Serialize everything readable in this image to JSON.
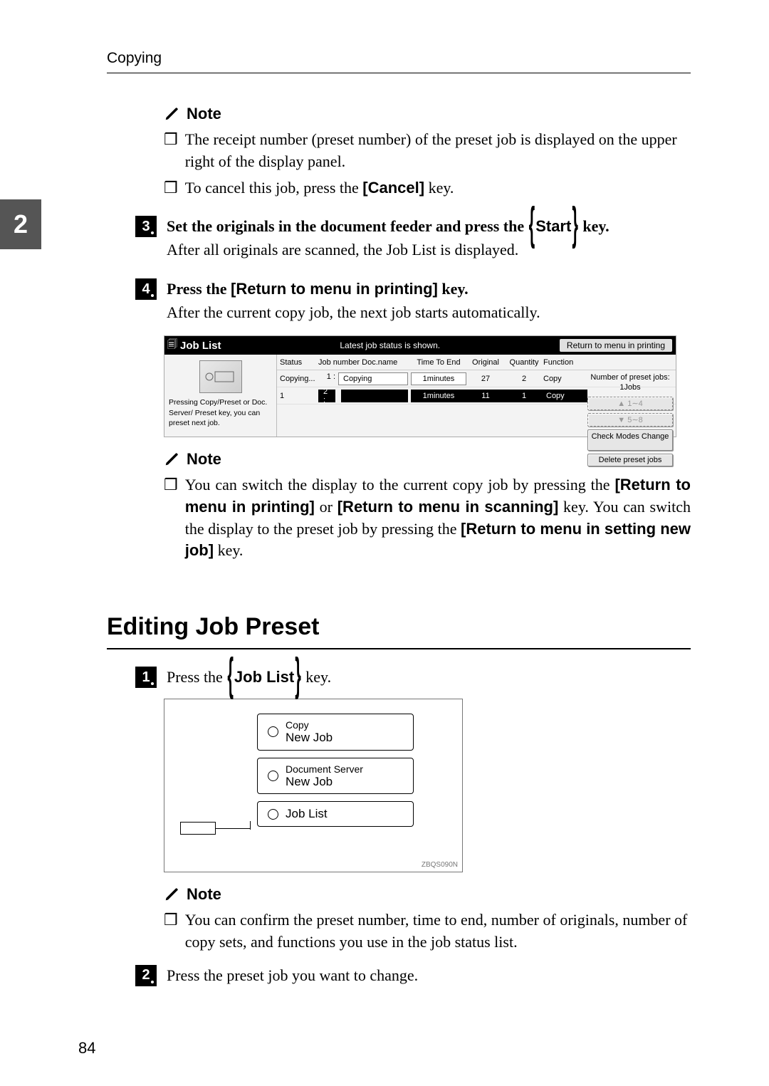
{
  "running_head": "Copying",
  "side_tab": "2",
  "note_label": "Note",
  "bullet_glyph": "❒",
  "notes1": [
    "The receipt number (preset number) of the preset job is displayed on the upper right of the display panel.",
    "To cancel this job, press the "
  ],
  "cancel_key": "[Cancel]",
  "after_cancel": " key.",
  "step3_prefix": "Set the originals in the document feeder and press the ",
  "step3_key": "Start",
  "step3_suffix": " key.",
  "step3_after": "After all originals are scanned, the Job List is displayed.",
  "step4_prefix": "Press the ",
  "step4_key": "[Return to menu in printing]",
  "step4_suffix": " key.",
  "step4_after": "After the current copy job, the next job starts automatically.",
  "joblist": {
    "title": "Job List",
    "subtitle": "Latest job status is shown.",
    "return_btn": "Return to menu in printing",
    "left_msg": "Pressing Copy/Preset or Doc. Server/ Preset key, you can preset next job.",
    "cols": {
      "status": "Status",
      "job": "Job number Doc.name",
      "tte": "Time To End",
      "orig": "Original",
      "qty": "Quantity",
      "func": "Function"
    },
    "row1": {
      "status": "Copying...",
      "job_lbl": "1 :",
      "job_val": "Copying",
      "tte": "1minutes",
      "orig": "27",
      "qty": "2",
      "func": "Copy"
    },
    "row2": {
      "status": "1",
      "job_lbl": "2 :",
      "tte": "1minutes",
      "orig": "11",
      "qty": "1",
      "func": "Copy"
    },
    "preset_count_lbl": "Number of preset jobs:",
    "preset_count_val": "1Jobs",
    "btn_up": "▲ 1∼4",
    "btn_down": "▼ 5∼8",
    "btn_check": "Check Modes Change",
    "btn_delete": "Delete preset jobs"
  },
  "notes2_pre": "You can switch the display to the current copy job by pressing the ",
  "notes2_key1": "[Return to menu in printing]",
  "notes2_mid": " or ",
  "notes2_key2": "[Return to menu in scanning]",
  "notes2_mid2": " key. You can switch the display to the preset job by pressing the ",
  "notes2_key3": "[Return to menu in setting new job]",
  "notes2_suf": " key.",
  "section_heading": "Editing Job Preset",
  "stepA_prefix": "Press the ",
  "stepA_key": "Job List",
  "stepA_suffix": " key.",
  "panel": {
    "btn1_line1": "Copy",
    "btn1_line2": "New Job",
    "btn2_line1": "Document Server",
    "btn2_line2": "New Job",
    "btn3": "Job List",
    "code": "ZBQS090N"
  },
  "notes3": "You can confirm the preset number, time to end, number of originals, number of copy sets, and functions you use in the job status list.",
  "stepB": "Press the preset job you want to change.",
  "page_num": "84"
}
